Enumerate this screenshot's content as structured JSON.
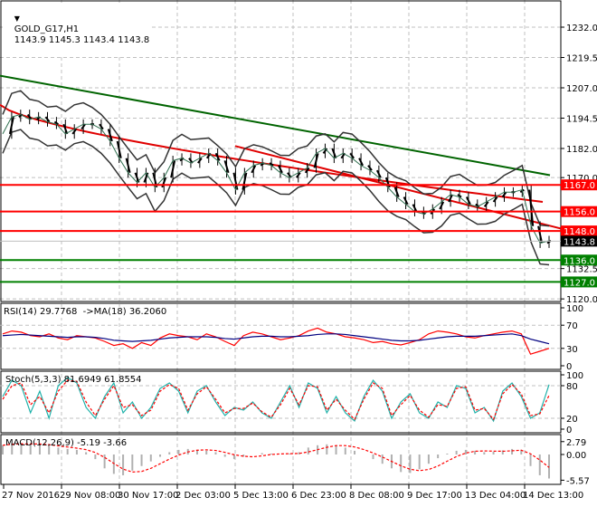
{
  "main": {
    "symbol": "GOLD_G17,H1",
    "ohlc": "1143.9 1145.3 1143.4 1143.8",
    "menu_icon": "triangle-down-icon",
    "price_ticks": [
      "1232.0",
      "1219.5",
      "1207.0",
      "1194.5",
      "1182.0",
      "1170.0",
      "1132.5",
      "1120.0"
    ],
    "levels": [
      {
        "price": 1167.0,
        "label": "1167.0",
        "color": "#ff0000"
      },
      {
        "price": 1156.0,
        "label": "1156.0",
        "color": "#ff0000"
      },
      {
        "price": 1148.0,
        "label": "1148.0",
        "color": "#ff0000"
      },
      {
        "price": 1136.0,
        "label": "1136.0",
        "color": "#008000"
      },
      {
        "price": 1127.0,
        "label": "1127.0",
        "color": "#008000"
      }
    ],
    "current_price": {
      "price": 1143.8,
      "label": "1143.8",
      "color": "#000000"
    }
  },
  "rsi": {
    "label": "RSI(14) 29.7768  ->MA(18) 36.2060",
    "ticks": [
      "100",
      "70",
      "30",
      "0"
    ]
  },
  "stoch": {
    "label": "Stoch(5,3,3) 81.6949 61.8554",
    "ticks": [
      "100",
      "80",
      "20",
      "0"
    ]
  },
  "macd": {
    "label": "MACD(12,26,9) -5.19 -3.66",
    "ticks": [
      "2.79",
      "0.00",
      "-5.57"
    ]
  },
  "time_axis": [
    "27 Nov 2016",
    "29 Nov 08:00",
    "30 Nov 17:00",
    "2 Dec 03:00",
    "5 Dec 13:00",
    "6 Dec 23:00",
    "8 Dec 08:00",
    "9 Dec 17:00",
    "13 Dec 04:00",
    "14 Dec 13:00"
  ],
  "chart_data": {
    "type": "line",
    "close": [
      1188,
      1195,
      1196,
      1194,
      1195,
      1193,
      1192,
      1188,
      1190,
      1192,
      1192,
      1190,
      1185,
      1178,
      1172,
      1168,
      1172,
      1166,
      1170,
      1177,
      1178,
      1176,
      1178,
      1180,
      1177,
      1172,
      1165,
      1172,
      1175,
      1176,
      1175,
      1172,
      1170,
      1172,
      1174,
      1180,
      1182,
      1178,
      1180,
      1178,
      1175,
      1173,
      1170,
      1166,
      1162,
      1159,
      1156,
      1155,
      1157,
      1160,
      1163,
      1162,
      1159,
      1158,
      1160,
      1162,
      1164,
      1164,
      1165,
      1150,
      1143,
      1144
    ],
    "ma_slow": [
      1212,
      1171
    ],
    "ma_mid": [
      1200,
      1160
    ],
    "trendline": [
      1183,
      1149
    ],
    "rsi": [
      55,
      60,
      58,
      52,
      50,
      55,
      48,
      45,
      52,
      50,
      48,
      42,
      35,
      38,
      30,
      40,
      35,
      48,
      55,
      52,
      50,
      45,
      55,
      50,
      42,
      35,
      52,
      58,
      55,
      50,
      45,
      48,
      52,
      60,
      65,
      58,
      55,
      50,
      48,
      45,
      40,
      42,
      38,
      36,
      40,
      45,
      55,
      60,
      58,
      55,
      50,
      48,
      52,
      55,
      58,
      60,
      55,
      20,
      25,
      30
    ],
    "rsi_ma": [
      52,
      53,
      54,
      53,
      52,
      51,
      50,
      49,
      50,
      50,
      49,
      47,
      44,
      43,
      42,
      43,
      44,
      46,
      48,
      49,
      50,
      50,
      50,
      49,
      47,
      46,
      48,
      50,
      51,
      51,
      50,
      50,
      51,
      52,
      54,
      55,
      55,
      54,
      52,
      50,
      48,
      46,
      44,
      43,
      43,
      44,
      46,
      48,
      50,
      51,
      51,
      51,
      52,
      53,
      54,
      55,
      52,
      46,
      42,
      38
    ],
    "stoch_k": [
      60,
      90,
      80,
      30,
      70,
      20,
      80,
      95,
      85,
      40,
      20,
      60,
      85,
      30,
      50,
      20,
      40,
      75,
      85,
      70,
      30,
      70,
      80,
      50,
      25,
      40,
      35,
      50,
      30,
      20,
      50,
      80,
      40,
      85,
      75,
      30,
      60,
      30,
      15,
      60,
      90,
      70,
      20,
      50,
      65,
      30,
      20,
      50,
      40,
      80,
      75,
      30,
      40,
      15,
      70,
      85,
      60,
      20,
      30,
      82
    ],
    "stoch_d": [
      55,
      80,
      85,
      45,
      60,
      30,
      70,
      90,
      88,
      50,
      25,
      55,
      80,
      40,
      45,
      25,
      35,
      70,
      82,
      75,
      35,
      65,
      78,
      55,
      30,
      38,
      38,
      48,
      32,
      22,
      45,
      75,
      45,
      80,
      78,
      35,
      55,
      35,
      18,
      55,
      85,
      75,
      25,
      45,
      62,
      35,
      22,
      45,
      42,
      75,
      78,
      35,
      38,
      18,
      65,
      82,
      65,
      25,
      28,
      62
    ],
    "macd_hist": [
      2,
      2.4,
      2.5,
      2.2,
      2,
      1.8,
      1.5,
      1.2,
      1,
      0.5,
      -1,
      -3,
      -4.2,
      -4.5,
      -3.5,
      -2.5,
      -1.5,
      -0.5,
      0.5,
      1,
      1.2,
      1,
      0.8,
      0.5,
      -0.5,
      -1,
      -0.5,
      0,
      0.3,
      0.2,
      0,
      0.2,
      0.5,
      1.5,
      2,
      2.2,
      2,
      1.5,
      0.8,
      0,
      -1,
      -2,
      -3,
      -3.8,
      -4,
      -3.2,
      -2,
      -0.8,
      0.2,
      0.8,
      1,
      0.8,
      0.5,
      0.6,
      0.9,
      1.2,
      1,
      -2.5,
      -4.5,
      -5.2
    ]
  }
}
